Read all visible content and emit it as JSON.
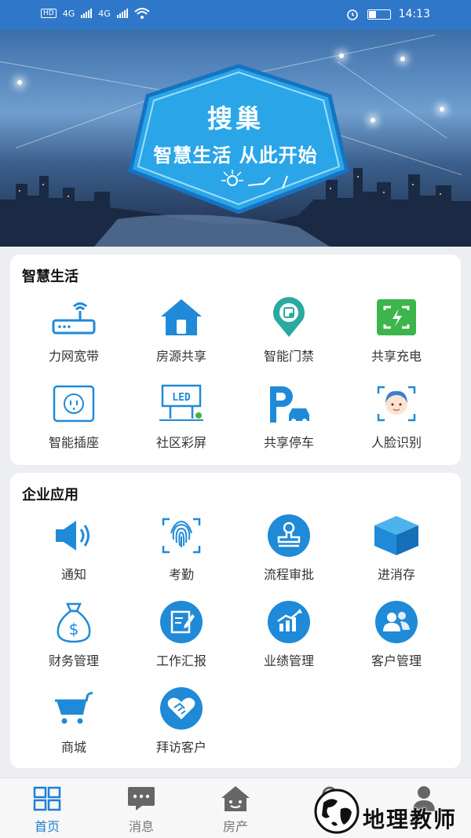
{
  "status_bar": {
    "left_indicators": [
      "HD",
      "4G",
      "4G"
    ],
    "time": "14:13"
  },
  "banner": {
    "title": "搜巢",
    "slogan": "智慧生活 从此开始"
  },
  "smart_life": {
    "title": "智慧生活",
    "items": [
      {
        "label": "力网宽带",
        "icon": "router-icon"
      },
      {
        "label": "房源共享",
        "icon": "house-icon"
      },
      {
        "label": "智能门禁",
        "icon": "access-control-icon"
      },
      {
        "label": "共享充电",
        "icon": "charging-icon"
      },
      {
        "label": "智能插座",
        "icon": "socket-icon"
      },
      {
        "label": "社区彩屏",
        "icon": "led-screen-icon"
      },
      {
        "label": "共享停车",
        "icon": "parking-icon"
      },
      {
        "label": "人脸识别",
        "icon": "face-recognition-icon"
      }
    ]
  },
  "enterprise": {
    "title": "企业应用",
    "items": [
      {
        "label": "通知",
        "icon": "speaker-icon"
      },
      {
        "label": "考勤",
        "icon": "fingerprint-icon"
      },
      {
        "label": "流程审批",
        "icon": "stamp-icon"
      },
      {
        "label": "进消存",
        "icon": "box-icon"
      },
      {
        "label": "财务管理",
        "icon": "money-bag-icon"
      },
      {
        "label": "工作汇报",
        "icon": "report-icon"
      },
      {
        "label": "业绩管理",
        "icon": "performance-chart-icon"
      },
      {
        "label": "客户管理",
        "icon": "customers-icon"
      },
      {
        "label": "商城",
        "icon": "cart-icon"
      },
      {
        "label": "拜访客户",
        "icon": "handshake-icon"
      }
    ]
  },
  "tabbar": [
    {
      "label": "首页",
      "icon": "home-grid-icon",
      "active": true
    },
    {
      "label": "消息",
      "icon": "message-icon",
      "active": false
    },
    {
      "label": "房产",
      "icon": "house-tab-icon",
      "active": false
    },
    {
      "label": "",
      "icon": "tab4-icon",
      "active": false
    },
    {
      "label": "",
      "icon": "profile-icon",
      "active": false
    }
  ],
  "watermark": {
    "text": "地理教师"
  },
  "colors": {
    "primary": "#1f7fd6",
    "icon_blue": "#1f8ad8",
    "green": "#3cb54a",
    "teal": "#2aa9a0",
    "status_bar": "#2f78c9"
  }
}
